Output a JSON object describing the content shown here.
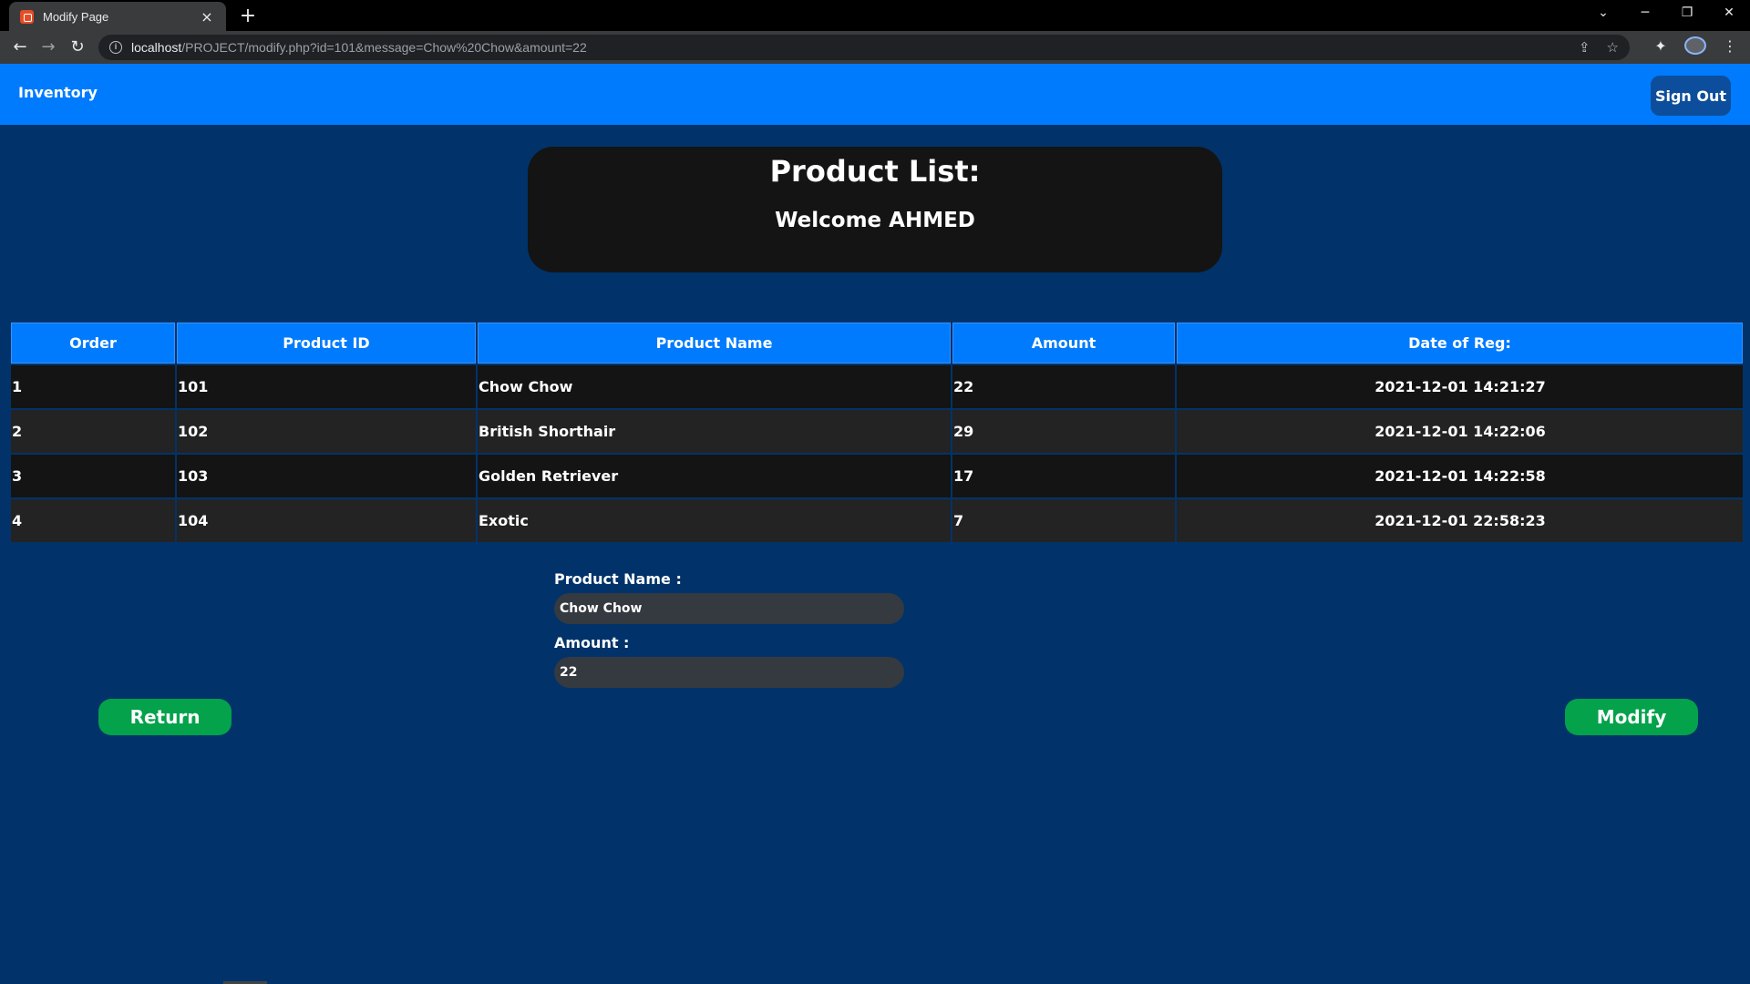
{
  "browser": {
    "tab_title": "Modify Page",
    "url_host": "localhost",
    "url_path": "/PROJECT/modify.php?id=101&message=Chow%20Chow&amount=22"
  },
  "navbar": {
    "brand": "Inventory",
    "signout_label": "Sign Out"
  },
  "header": {
    "title": "Product List:",
    "welcome": "Welcome AHMED"
  },
  "table": {
    "columns": [
      "Order",
      "Product ID",
      "Product Name",
      "Amount",
      "Date of Reg:"
    ],
    "rows": [
      [
        "1",
        "101",
        "Chow Chow",
        "22",
        "2021-12-01 14:21:27"
      ],
      [
        "2",
        "102",
        "British Shorthair",
        "29",
        "2021-12-01 14:22:06"
      ],
      [
        "3",
        "103",
        "Golden Retriever",
        "17",
        "2021-12-01 14:22:58"
      ],
      [
        "4",
        "104",
        "Exotic",
        "7",
        "2021-12-01 22:58:23"
      ]
    ]
  },
  "form": {
    "product_name_label": "Product Name :",
    "product_name_value": "Chow Chow",
    "amount_label": "Amount :",
    "amount_value": "22"
  },
  "buttons": {
    "return_label": "Return",
    "modify_label": "Modify"
  },
  "colors": {
    "page_bg": "#01336a",
    "navbar": "#017bfe",
    "signout_bg": "#0d4e9c",
    "card_bg": "#141414",
    "green_button": "#03a24b",
    "input_bg": "#343a40"
  }
}
